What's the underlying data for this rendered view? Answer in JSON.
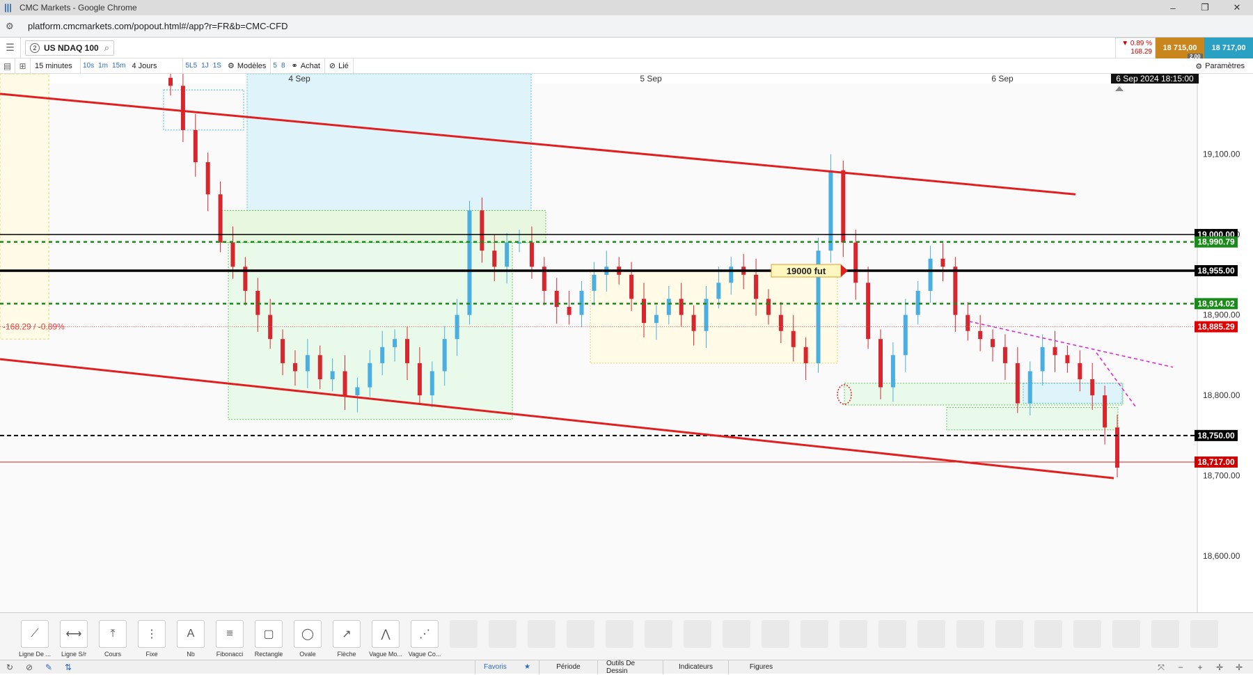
{
  "window": {
    "title": "CMC Markets - Google Chrome",
    "controls": [
      "–",
      "❐",
      "✕"
    ]
  },
  "browser": {
    "url": "platform.cmcmarkets.com/popout.html#/app?r=FR&b=CMC-CFD"
  },
  "instrument": {
    "badge": "2",
    "name": "US NDAQ 100"
  },
  "quote": {
    "change_pct": "▼ 0.89 %",
    "change_pts": "168.29",
    "sell": "18 715,00",
    "buy": "18 717,00",
    "spread": "2.00"
  },
  "toolbar": {
    "interval": "15 minutes",
    "quick_intervals": [
      "10s",
      "1m",
      "15m"
    ],
    "range": "4 Jours",
    "quick_ranges": [
      "5L5",
      "1J",
      "1S"
    ],
    "models": "Modèles",
    "nums": [
      "5",
      "8"
    ],
    "achat": "Achat",
    "link": "Lié",
    "settings": "Paramètres"
  },
  "chart_data": {
    "type": "candlestick",
    "instrument": "US NDAQ 100",
    "x_axis_labels": [
      "4 Sep",
      "5 Sep",
      "6 Sep"
    ],
    "crosshair_time": "6 Sep 2024 18:15:00",
    "y_ticks": [
      "19,100.00",
      "19,000.00",
      "18,900.00",
      "18,800.00",
      "18,700.00",
      "18,600.00"
    ],
    "ylim": [
      18530,
      19200
    ],
    "last_price": 18717.0,
    "change_label": "-168.29 / -0.89%",
    "tagged_levels": [
      {
        "label": "19,000.00",
        "value": 19000.0,
        "color": "#000000"
      },
      {
        "label": "18,990.79",
        "value": 18990.79,
        "color": "#1a8a1a"
      },
      {
        "label": "18,955.00",
        "value": 18955.0,
        "color": "#000000"
      },
      {
        "label": "18,914.02",
        "value": 18914.02,
        "color": "#1a8a1a"
      },
      {
        "label": "18,885.29",
        "value": 18885.29,
        "color": "#e00000"
      },
      {
        "label": "18,750.00",
        "value": 18750.0,
        "color": "#000000"
      },
      {
        "label": "18,717.00",
        "value": 18717.0,
        "color": "#cc0000"
      }
    ],
    "annotation": "19000  fut",
    "close_series": [
      19185,
      19130,
      19090,
      19050,
      18990,
      18960,
      18930,
      18900,
      18870,
      18840,
      18830,
      18850,
      18820,
      18830,
      18800,
      18810,
      18840,
      18860,
      18870,
      18840,
      18800,
      18830,
      18870,
      18900,
      19030,
      18980,
      18960,
      18990,
      18990,
      18960,
      18930,
      18910,
      18900,
      18930,
      18950,
      18960,
      18950,
      18920,
      18890,
      18900,
      18920,
      18900,
      18880,
      18920,
      18940,
      18960,
      18950,
      18920,
      18900,
      18880,
      18860,
      18840,
      18980,
      19080,
      18990,
      18940,
      18870,
      18810,
      18850,
      18900,
      18930,
      18970,
      18960,
      18900,
      18880,
      18870,
      18860,
      18840,
      18790,
      18830,
      18860,
      18850,
      18840,
      18820,
      18800,
      18760,
      18710
    ]
  },
  "draw_tools": [
    {
      "label": "Ligne De ...",
      "icon": "trendline-icon",
      "glyph": "⟋"
    },
    {
      "label": "Ligne S/r",
      "icon": "sr-line-icon",
      "glyph": "⟷"
    },
    {
      "label": "Cours",
      "icon": "price-line-icon",
      "glyph": "⤒"
    },
    {
      "label": "Fixe",
      "icon": "fixed-line-icon",
      "glyph": "⋮"
    },
    {
      "label": "Nb",
      "icon": "text-icon",
      "glyph": "A"
    },
    {
      "label": "Fibonacci",
      "icon": "fibonacci-icon",
      "glyph": "≡"
    },
    {
      "label": "Rectangle",
      "icon": "rectangle-icon",
      "glyph": "▢"
    },
    {
      "label": "Ovale",
      "icon": "oval-icon",
      "glyph": "◯"
    },
    {
      "label": "Flèche",
      "icon": "arrow-icon",
      "glyph": "↗"
    },
    {
      "label": "Vague Mo...",
      "icon": "wave-icon",
      "glyph": "⋀"
    },
    {
      "label": "Vague Co...",
      "icon": "wave2-icon",
      "glyph": "⋰"
    }
  ],
  "status_tabs": [
    "Favoris",
    "Période",
    "Outils De Dessin",
    "Indicateurs",
    "Figures"
  ]
}
